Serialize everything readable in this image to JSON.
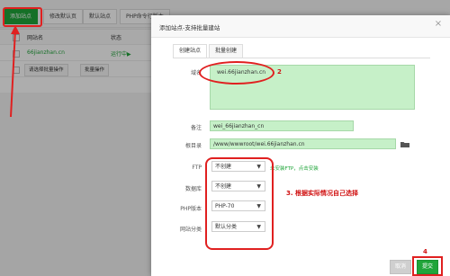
{
  "toolbar": {
    "add_site": "添加站点",
    "modify_default": "修改默认页",
    "default_site": "默认站点",
    "php_cli": "PHP命令行版本"
  },
  "table": {
    "col_site": "网站名",
    "col_status": "状态",
    "row_site": "66jianzhan.cn",
    "row_status": "运行中▶",
    "batch_select": "请选择批量操作",
    "batch_button": "批量操作"
  },
  "modal": {
    "title": "添加站点-支持批量建站",
    "tabs": [
      "创建站点",
      "批量创建"
    ],
    "domain_label": "域名",
    "domain_value": "wei.66jianzhan.cn",
    "remark_label": "备注",
    "remark_value": "wei_66jianzhan_cn",
    "root_label": "根目录",
    "root_value": "/www/wwwroot/wei.66jianzhan.cn",
    "ftp_label": "FTP",
    "ftp_value": "不创建",
    "ftp_hint": "未安装FTP，点击安装",
    "db_label": "数据库",
    "db_value": "不创建",
    "php_label": "PHP版本",
    "php_value": "PHP-70",
    "category_label": "网站分类",
    "category_value": "默认分类",
    "cancel": "取消",
    "submit": "提交"
  },
  "annotations": {
    "num2": "2",
    "note3": "3. 根据实际情况自己选择",
    "num4": "4"
  },
  "colors": {
    "accent_green": "#20a53a",
    "annotation_red": "#e02020",
    "field_green": "#c6f0c8"
  }
}
